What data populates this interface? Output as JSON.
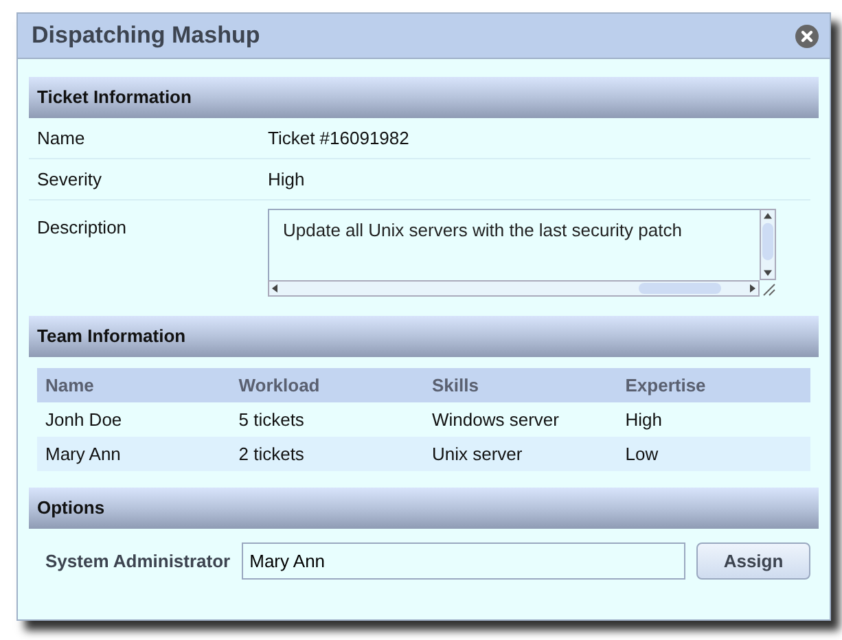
{
  "window": {
    "title": "Dispatching Mashup"
  },
  "ticket_information": {
    "heading": "Ticket Information",
    "fields": [
      {
        "label": "Name",
        "value": "Ticket #16091982",
        "kind": "text"
      },
      {
        "label": "Severity",
        "value": "High",
        "kind": "text"
      },
      {
        "label": "Description",
        "value": "Update all Unix servers with the last security patch",
        "kind": "textarea"
      }
    ]
  },
  "team_information": {
    "heading": "Team Information",
    "columns": [
      "Name",
      "Workload",
      "Skills",
      "Expertise"
    ],
    "rows": [
      [
        "Jonh Doe",
        "5 tickets",
        "Windows server",
        "High"
      ],
      [
        "Mary Ann",
        "2 tickets",
        "Unix server",
        "Low"
      ]
    ]
  },
  "options": {
    "heading": "Options",
    "label": "System Administrator",
    "value": "Mary Ann",
    "button": "Assign"
  }
}
